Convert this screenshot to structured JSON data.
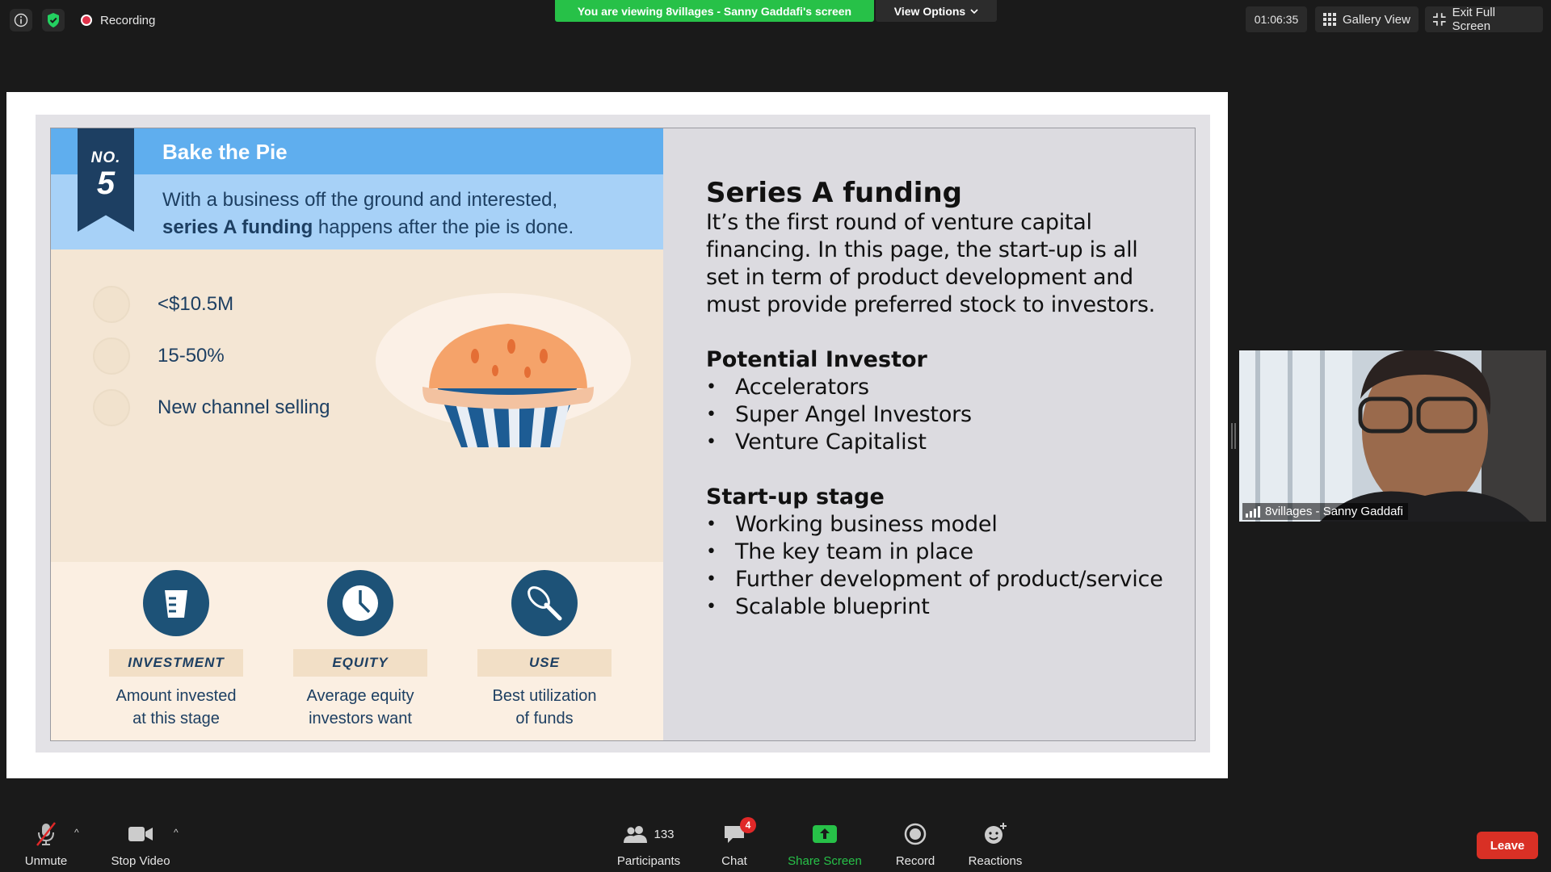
{
  "top_bar": {
    "recording_label": "Recording",
    "viewing_banner": "You are viewing 8villages - Sanny Gaddafi's screen",
    "view_options_label": "View Options",
    "timer": "01:06:35",
    "gallery_view_label": "Gallery View",
    "exit_full_screen_label": "Exit Full Screen",
    "icons": [
      "info-icon",
      "shield-check-icon",
      "recording-dot-icon",
      "chevron-down-icon",
      "grid-icon",
      "exit-fullscreen-icon"
    ]
  },
  "slide": {
    "infographic": {
      "no_label": "NO.",
      "number": "5",
      "title": "Bake the Pie",
      "desc_line1": "With a business off the ground and interested,",
      "desc_bold": "series A funding",
      "desc_rest": " happens after the pie is done.",
      "stats": [
        {
          "icon": "cup-icon",
          "text": "<$10.5M"
        },
        {
          "icon": "clock-icon",
          "text": "15-50%"
        },
        {
          "icon": "whisk-icon",
          "text": "New channel selling"
        }
      ],
      "features": [
        {
          "icon": "measuring-cup-icon",
          "label": "INVESTMENT",
          "desc1": "Amount invested",
          "desc2": "at this stage"
        },
        {
          "icon": "clock-icon",
          "label": "EQUITY",
          "desc1": "Average equity",
          "desc2": "investors want"
        },
        {
          "icon": "whisk-icon",
          "label": "USE",
          "desc1": "Best utilization",
          "desc2": "of funds"
        }
      ],
      "colors": {
        "dark_blue": "#1d5277",
        "light_blue": "#a7d1f7",
        "bright_blue": "#5faeee",
        "cream": "#f4e6d4",
        "pie_orange": "#f5a36a"
      }
    },
    "text_panel": {
      "title": "Series A funding",
      "body": "It’s the first round of venture capital financing. In this page, the start-up is all set in term of product development and must provide preferred stock to investors.",
      "potential_investor_heading": "Potential Investor",
      "potential_investors": [
        "Accelerators",
        "Super Angel Investors",
        "Venture Capitalist"
      ],
      "startup_stage_heading": "Start-up stage",
      "startup_stage_items": [
        "Working business model",
        "The key team in place",
        "Further development of product/service",
        "Scalable blueprint"
      ]
    }
  },
  "video": {
    "participant_name": "8villages - Sanny Gaddafi"
  },
  "toolbar": {
    "unmute_label": "Unmute",
    "stop_video_label": "Stop Video",
    "participants_label": "Participants",
    "participants_count": "133",
    "chat_label": "Chat",
    "chat_badge": "4",
    "share_screen_label": "Share Screen",
    "record_label": "Record",
    "reactions_label": "Reactions",
    "leave_label": "Leave",
    "colors": {
      "share_green": "#27c148",
      "leave_red": "#d93025",
      "badge_red": "#e02828"
    }
  }
}
